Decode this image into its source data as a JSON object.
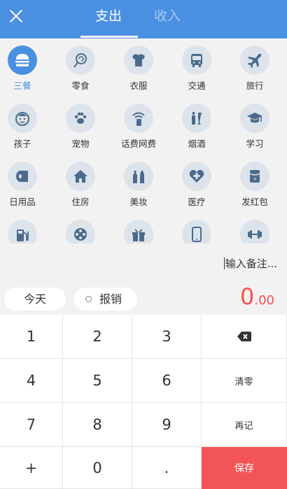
{
  "header": {
    "tabs": [
      {
        "label": "支出",
        "active": true
      },
      {
        "label": "收入",
        "active": false
      }
    ],
    "accent_color": "#4a90e2"
  },
  "categories": [
    {
      "label": "三餐",
      "icon": "burger-icon",
      "active": true
    },
    {
      "label": "零食",
      "icon": "lollipop-icon"
    },
    {
      "label": "衣服",
      "icon": "tshirt-icon"
    },
    {
      "label": "交通",
      "icon": "bus-icon"
    },
    {
      "label": "旅行",
      "icon": "airplane-icon"
    },
    {
      "label": "孩子",
      "icon": "child-face-icon"
    },
    {
      "label": "宠物",
      "icon": "paw-icon"
    },
    {
      "label": "话费网费",
      "icon": "wifi-phone-icon"
    },
    {
      "label": "烟酒",
      "icon": "bottle-icon"
    },
    {
      "label": "学习",
      "icon": "graduation-cap-icon"
    },
    {
      "label": "日用品",
      "icon": "toilet-paper-icon"
    },
    {
      "label": "住房",
      "icon": "house-icon"
    },
    {
      "label": "美妆",
      "icon": "cosmetics-icon"
    },
    {
      "label": "医疗",
      "icon": "medical-heart-icon"
    },
    {
      "label": "发红包",
      "icon": "red-packet-icon"
    },
    {
      "label": "",
      "icon": "gas-pump-icon"
    },
    {
      "label": "",
      "icon": "film-reel-icon"
    },
    {
      "label": "",
      "icon": "gift-icon"
    },
    {
      "label": "",
      "icon": "smartphone-icon"
    },
    {
      "label": "",
      "icon": "dumbbell-icon"
    }
  ],
  "note": {
    "placeholder": "输入备注..."
  },
  "date_button": "今天",
  "reimburse_label": "报销",
  "amount": {
    "integer": "0",
    "decimal": ".00"
  },
  "keypad": {
    "rows": [
      [
        "1",
        "2",
        "3",
        "backspace"
      ],
      [
        "4",
        "5",
        "6",
        "清零"
      ],
      [
        "7",
        "8",
        "9",
        "再记"
      ],
      [
        "+",
        "0",
        ".",
        "保存"
      ]
    ]
  },
  "colors": {
    "save": "#f25555",
    "amount": "#ff4f4f"
  }
}
